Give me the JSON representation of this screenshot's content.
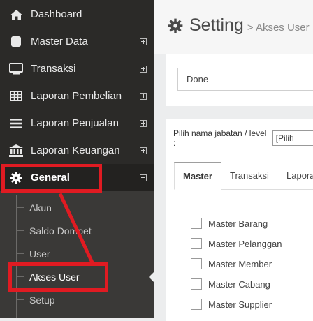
{
  "sidebar": {
    "items": [
      {
        "label": "Dashboard",
        "icon": "home-icon"
      },
      {
        "label": "Master Data",
        "icon": "database-icon"
      },
      {
        "label": "Transaksi",
        "icon": "monitor-icon"
      },
      {
        "label": "Laporan Pembelian",
        "icon": "table-icon"
      },
      {
        "label": "Laporan Penjualan",
        "icon": "list-icon"
      },
      {
        "label": "Laporan Keuangan",
        "icon": "bank-icon"
      },
      {
        "label": "General",
        "icon": "gear-icon"
      }
    ],
    "submenu": [
      {
        "label": "Akun"
      },
      {
        "label": "Saldo Dompet"
      },
      {
        "label": "User"
      },
      {
        "label": "Akses User"
      },
      {
        "label": "Setup"
      }
    ]
  },
  "header": {
    "title": "Setting",
    "subtitle": "> Akses User"
  },
  "form": {
    "top_select_value": "Done",
    "level_label": "Pilih nama jabatan / level :",
    "level_select_value": "[Pilih"
  },
  "tabs": [
    {
      "label": "Master"
    },
    {
      "label": "Transaksi"
    },
    {
      "label": "Lapora"
    }
  ],
  "permissions": [
    {
      "label": "Master Barang"
    },
    {
      "label": "Master Pelanggan"
    },
    {
      "label": "Master Member"
    },
    {
      "label": "Master Cabang"
    },
    {
      "label": "Master Supplier"
    }
  ],
  "colors": {
    "sidebar_bg": "#2b2a28",
    "submenu_bg": "#3a3937",
    "annotation_red": "#e01b22"
  }
}
